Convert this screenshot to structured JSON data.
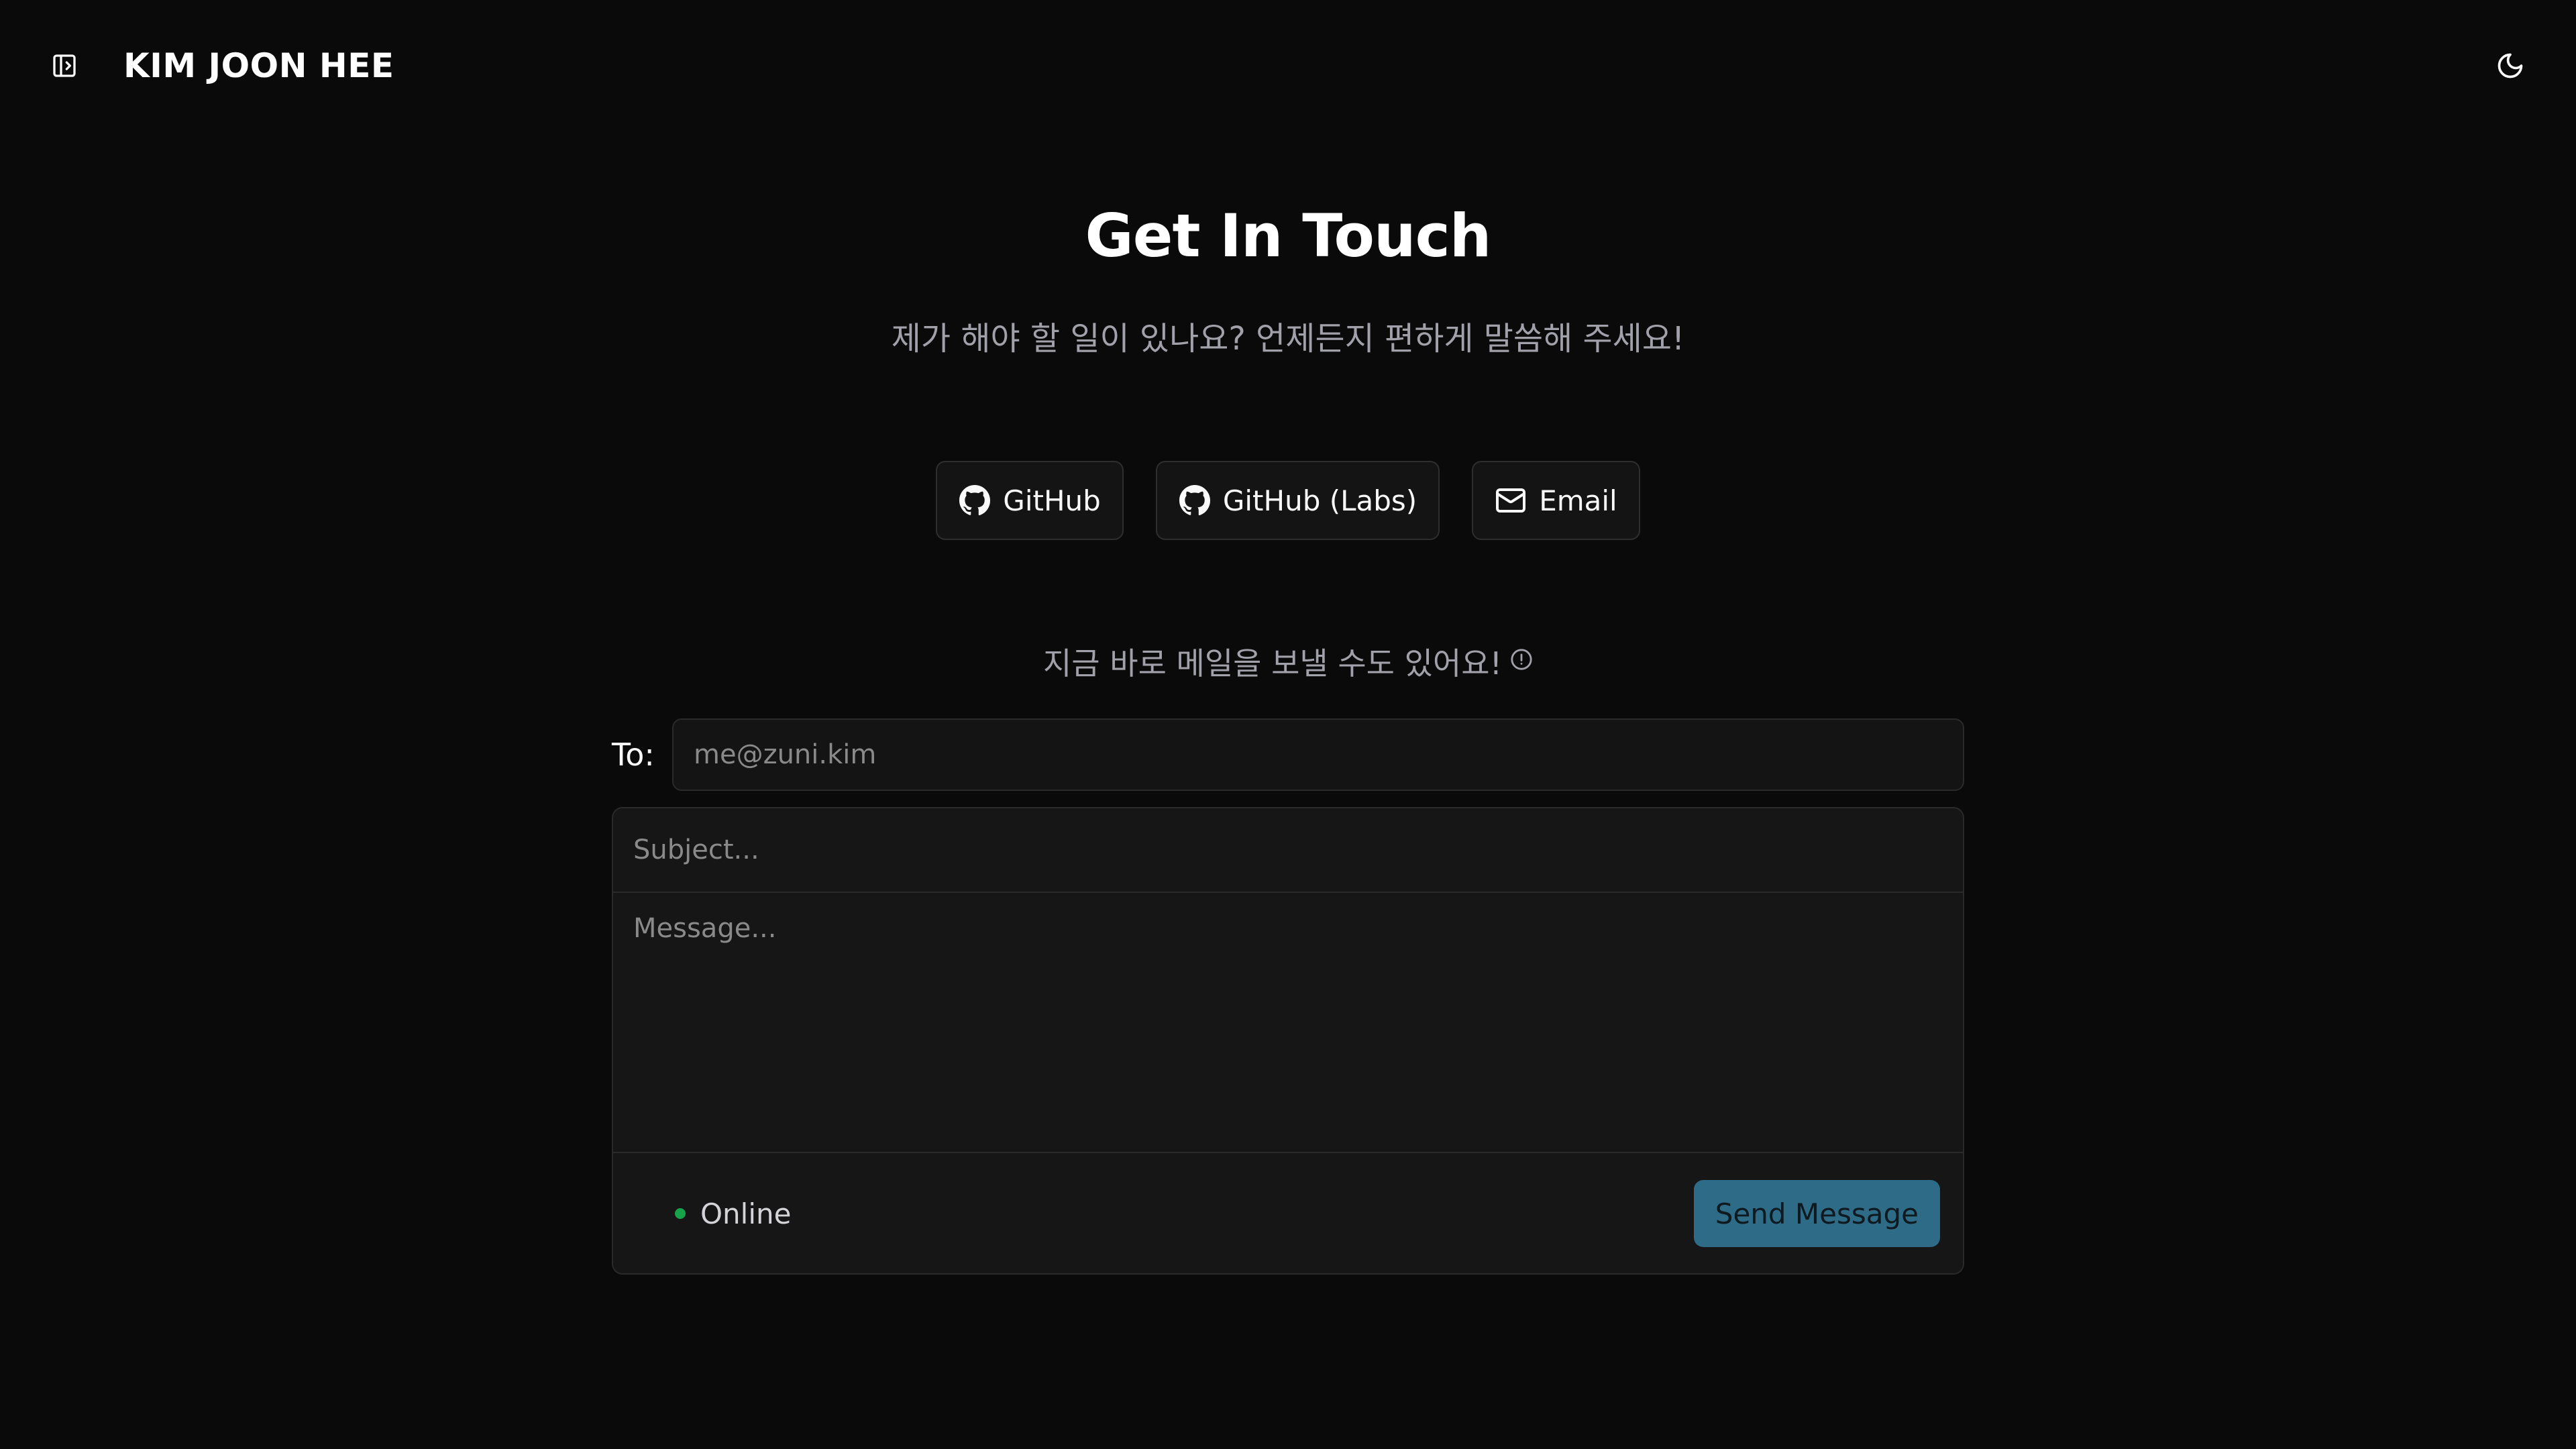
{
  "header": {
    "title": "KIM JOON HEE",
    "sidebar_toggle_icon": "panel-left-icon",
    "theme_toggle_icon": "moon-icon"
  },
  "hero": {
    "title": "Get In Touch",
    "subtitle": "제가 해야 할 일이 있나요? 언제든지 편하게 말씀해 주세요!"
  },
  "links": [
    {
      "label": "GitHub",
      "icon": "github-icon"
    },
    {
      "label": "GitHub (Labs)",
      "icon": "github-icon"
    },
    {
      "label": "Email",
      "icon": "mail-icon"
    }
  ],
  "mail_hint": {
    "text": "지금 바로 메일을 보낼 수도 있어요!",
    "icon": "info-icon"
  },
  "form": {
    "to_label": "To:",
    "to_placeholder": "me@zuni.kim",
    "subject_placeholder": "Subject...",
    "message_placeholder": "Message...",
    "status_text": "Online",
    "status_color": "#16a34a",
    "send_label": "Send Message",
    "send_color": "#2e6b86"
  },
  "colors": {
    "background": "#0a0a0a",
    "surface": "#161616",
    "border": "#2a2a2a",
    "muted_text": "#a1a1aa"
  }
}
